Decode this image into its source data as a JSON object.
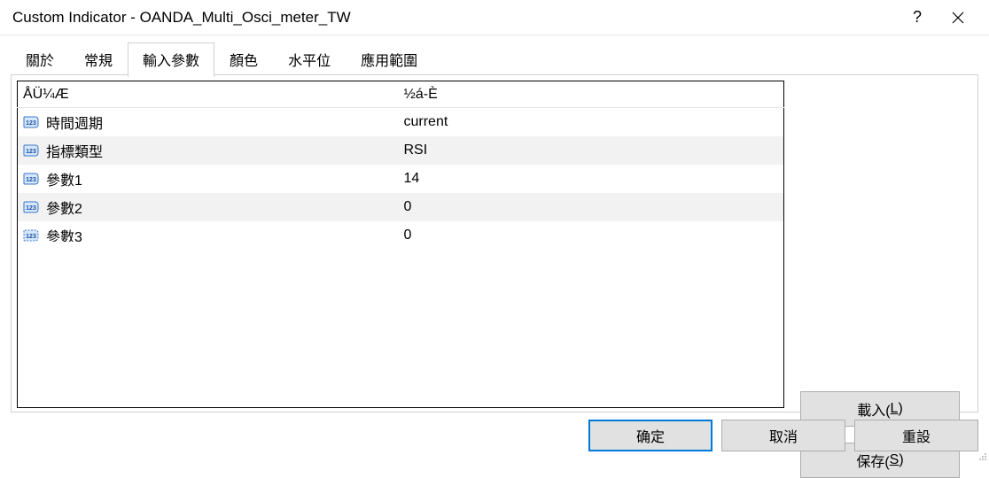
{
  "window": {
    "title": "Custom Indicator - OANDA_Multi_Osci_meter_TW"
  },
  "tabs": [
    {
      "label": "關於",
      "active": false
    },
    {
      "label": "常規",
      "active": false
    },
    {
      "label": "輸入參數",
      "active": true
    },
    {
      "label": "顏色",
      "active": false
    },
    {
      "label": "水平位",
      "active": false
    },
    {
      "label": "應用範圍",
      "active": false
    }
  ],
  "params": {
    "headers": {
      "name": "ÅÜ¼Æ",
      "value": "½á-È"
    },
    "rows": [
      {
        "name": "時間週期",
        "value": "current",
        "icon": "solid"
      },
      {
        "name": "指標類型",
        "value": "RSI",
        "icon": "solid"
      },
      {
        "name": "參數1",
        "value": "14",
        "icon": "solid"
      },
      {
        "name": "參數2",
        "value": "0",
        "icon": "solid"
      },
      {
        "name": "參數3",
        "value": "0",
        "icon": "dotted"
      }
    ]
  },
  "side_buttons": {
    "load": {
      "text": "載入(",
      "key": "L",
      "tail": ")"
    },
    "save": {
      "text": "保存(",
      "key": "S",
      "tail": ")"
    }
  },
  "bottom_buttons": {
    "ok": "确定",
    "cancel": "取消",
    "reset": "重設"
  }
}
